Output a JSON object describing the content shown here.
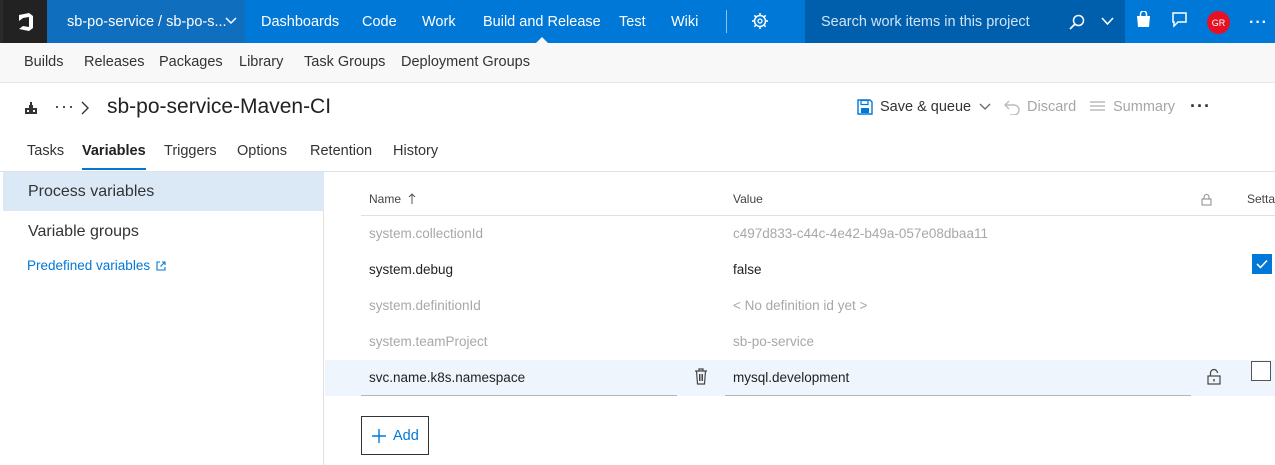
{
  "topbar": {
    "project": "sb-po-service / sb-po-s...",
    "hubs": [
      "Dashboards",
      "Code",
      "Work",
      "Build and Release",
      "Test",
      "Wiki"
    ],
    "active_hub": "Build and Release",
    "search_placeholder": "Search work items in this project",
    "avatar_initials": "GR",
    "accent": "#0078d7",
    "avatar_color": "#e81123"
  },
  "subnav": {
    "items": [
      "Builds",
      "Releases",
      "Packages",
      "Library",
      "Task Groups",
      "Deployment Groups"
    ]
  },
  "header": {
    "breadcrumb_ellipsis": "···",
    "title": "sb-po-service-Maven-CI",
    "actions": {
      "save_queue": "Save & queue",
      "discard": "Discard",
      "summary": "Summary"
    },
    "more": "···"
  },
  "tabs": [
    "Tasks",
    "Variables",
    "Triggers",
    "Options",
    "Retention",
    "History"
  ],
  "active_tab": "Variables",
  "leftpanel": {
    "items": [
      "Process variables",
      "Variable groups"
    ],
    "selected": "Process variables",
    "link": "Predefined variables"
  },
  "grid": {
    "columns": {
      "name": "Name",
      "value": "Value",
      "settable": "Setta"
    },
    "rows": [
      {
        "name": "system.collectionId",
        "value": "c497d833-c44c-4e42-b49a-057e08dbaa11",
        "readonly": true
      },
      {
        "name": "system.debug",
        "value": "false",
        "readonly": false,
        "settable": true
      },
      {
        "name": "system.definitionId",
        "value": "< No definition id yet >",
        "readonly": true
      },
      {
        "name": "system.teamProject",
        "value": "sb-po-service",
        "readonly": true
      },
      {
        "name": "svc.name.k8s.namespace",
        "value": "mysql.development",
        "readonly": false,
        "settable": false
      }
    ],
    "add_label": "Add"
  }
}
